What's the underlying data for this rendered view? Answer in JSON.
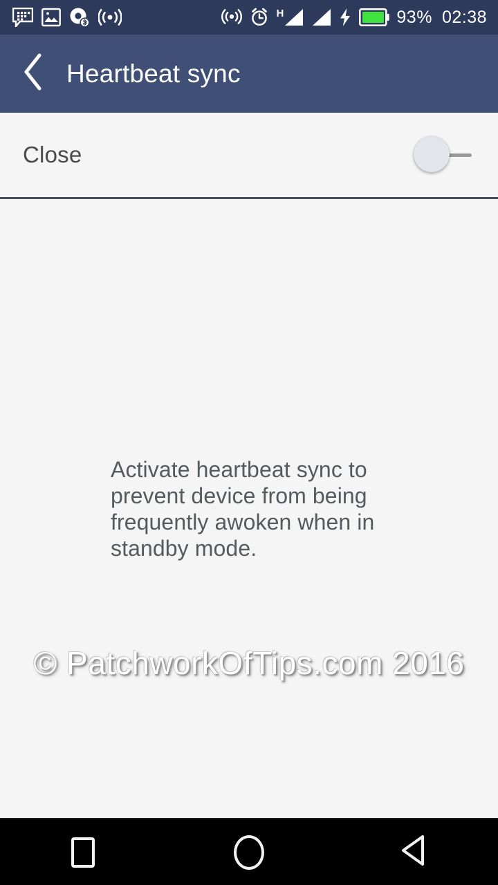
{
  "statusbar": {
    "background_color": "#2e3a5c",
    "left_icons": [
      {
        "name": "bbm-messenger-icon",
        "label": "BBM message"
      },
      {
        "name": "photo-gallery-icon",
        "label": "Photo"
      },
      {
        "name": "disc-bluetooth-icon",
        "label": "Media over Bluetooth"
      },
      {
        "name": "wifi-signal-icon",
        "label": "Wi-Fi"
      }
    ],
    "right_icons": [
      {
        "name": "hotspot-icon",
        "label": "Hotspot"
      },
      {
        "name": "alarm-clock-icon",
        "label": "Alarm set"
      },
      {
        "name": "network-type-h-icon",
        "label": "H"
      },
      {
        "name": "signal-bars-sim1-icon",
        "label": "SIM 1 signal"
      },
      {
        "name": "signal-bars-sim2-icon",
        "label": "SIM 2 signal"
      },
      {
        "name": "charging-bolt-icon",
        "label": "Charging"
      },
      {
        "name": "battery-icon",
        "label": "Battery"
      }
    ],
    "network_type": "H",
    "battery_percent": "93%",
    "battery_color": "#3fe23f",
    "time": "02:38"
  },
  "appbar": {
    "background_color": "#3f4f75",
    "back_icon": "chevron-left-icon",
    "title": "Heartbeat sync"
  },
  "settings": {
    "toggle_row": {
      "label": "Close",
      "toggle_state": "off",
      "thumb_color": "#e2e6ec",
      "track_color": "#9a9a9a"
    },
    "description": "Activate heartbeat sync to prevent device from being frequently awoken when in standby mode."
  },
  "watermark": {
    "text": "© PatchworkOfTips.com 2016"
  },
  "navbar": {
    "background_color": "#000000",
    "buttons": [
      {
        "name": "recents-button",
        "icon": "square-icon"
      },
      {
        "name": "home-button",
        "icon": "circle-icon"
      },
      {
        "name": "back-button",
        "icon": "triangle-left-icon"
      }
    ]
  }
}
